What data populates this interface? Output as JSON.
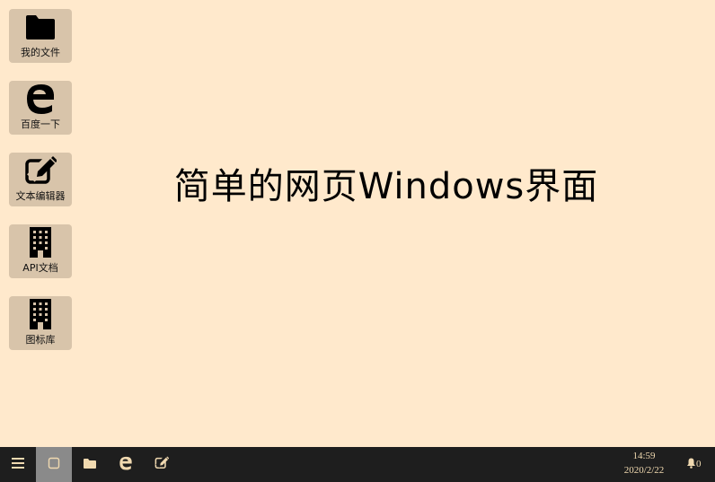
{
  "desktop": {
    "headline": "简单的网页Windows界面",
    "icons": [
      {
        "label": "我的文件",
        "icon": "folder-icon"
      },
      {
        "label": "百度一下",
        "icon": "edge-icon"
      },
      {
        "label": "文本编辑器",
        "icon": "edit-icon"
      },
      {
        "label": "API文档",
        "icon": "building-icon"
      },
      {
        "label": "图标库",
        "icon": "building-icon"
      }
    ]
  },
  "taskbar": {
    "buttons": [
      {
        "name": "start-menu",
        "icon": "menu-icon",
        "active": false
      },
      {
        "name": "desktop-view",
        "icon": "window-icon",
        "active": true
      },
      {
        "name": "files",
        "icon": "folder-icon",
        "active": false
      },
      {
        "name": "browser",
        "icon": "edge-icon",
        "active": false
      },
      {
        "name": "editor",
        "icon": "edit-icon",
        "active": false
      }
    ],
    "time": "14:59",
    "date": "2020/2/22",
    "notification_count": "0"
  },
  "colors": {
    "desktop_bg": "#ffe9cc",
    "icon_tile_bg": "#d8c4aa",
    "taskbar_bg": "#1e1e1e",
    "taskbar_active": "#8a8a8a",
    "taskbar_text": "#f0d9b0"
  }
}
